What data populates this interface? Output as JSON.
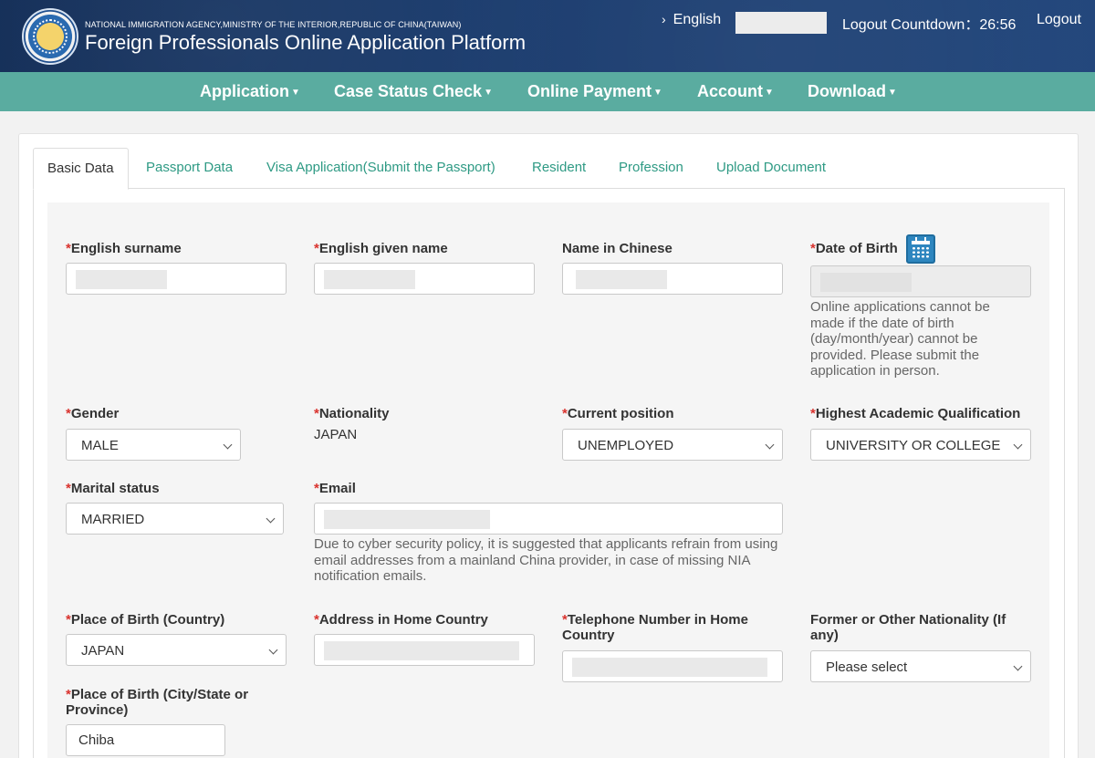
{
  "header": {
    "agency": "NATIONAL IMMIGRATION AGENCY,MINISTRY OF THE INTERIOR,REPUBLIC OF CHINA(TAIWAN)",
    "platform": "Foreign Professionals Online Application Platform",
    "language": "English",
    "countdown": "Logout Countdown：26:56",
    "logout": "Logout"
  },
  "nav": {
    "items": [
      {
        "label": "Application"
      },
      {
        "label": "Case Status Check"
      },
      {
        "label": "Online Payment"
      },
      {
        "label": "Account"
      },
      {
        "label": "Download"
      }
    ]
  },
  "tabs": [
    {
      "label": "Basic Data",
      "active": true
    },
    {
      "label": "Passport Data"
    },
    {
      "label": "Visa Application(Submit the Passport)"
    },
    {
      "label": "Resident"
    },
    {
      "label": "Profession"
    },
    {
      "label": "Upload Document"
    }
  ],
  "form": {
    "required_mark": "*",
    "english_surname": {
      "label": "English surname"
    },
    "english_given_name": {
      "label": "English given name"
    },
    "name_in_chinese": {
      "label": "Name in Chinese"
    },
    "date_of_birth": {
      "label": "Date of Birth",
      "help": "Online applications cannot be made if the date of birth (day/month/year) cannot be provided. Please submit the application in person."
    },
    "gender": {
      "label": "Gender",
      "value": "MALE"
    },
    "nationality": {
      "label": "Nationality",
      "value": "JAPAN"
    },
    "current_position": {
      "label": "Current position",
      "value": "UNEMPLOYED"
    },
    "highest_qualification": {
      "label": "Highest Academic Qualification",
      "value": "UNIVERSITY OR COLLEGE"
    },
    "marital_status": {
      "label": "Marital status",
      "value": "MARRIED"
    },
    "email": {
      "label": "Email",
      "help": "Due to cyber security policy, it is suggested that applicants refrain from using email addresses from a mainland China provider, in case of missing NIA notification emails."
    },
    "place_of_birth_country": {
      "label": "Place of Birth (Country)",
      "value": "JAPAN"
    },
    "address_home_country": {
      "label": "Address in Home Country"
    },
    "telephone_home_country": {
      "label": "Telephone Number in Home Country"
    },
    "former_nationality": {
      "label": "Former or Other Nationality (If any)",
      "value": "Please select"
    },
    "place_of_birth_city": {
      "label": "Place of Birth (City/State or Province)",
      "value": "Chiba"
    }
  },
  "icons": {
    "calendar": "calendar-icon",
    "chevron": "chevron-down-icon",
    "language": "chevron-right-icon"
  },
  "colors": {
    "header_bg": "#1b3c6e",
    "nav_bg": "#5aaca0",
    "tab_link": "#2e9a84",
    "required": "#d9332e"
  }
}
